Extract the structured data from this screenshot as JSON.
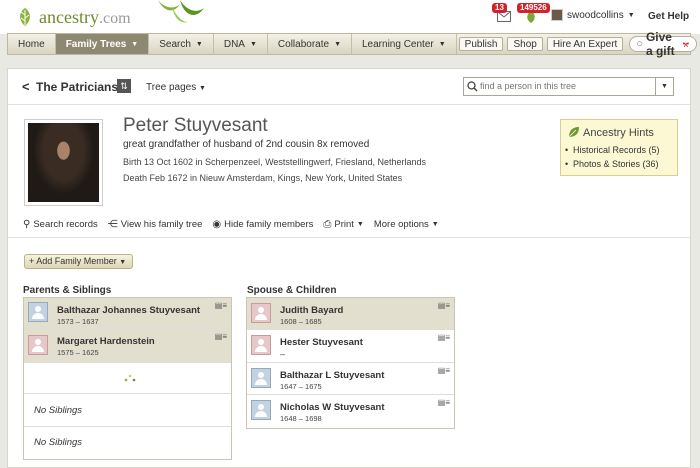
{
  "brand": {
    "logo_text": "ancestry",
    "logo_suffix": ".com",
    "accent": "#6e8b2f"
  },
  "header": {
    "messages_count": "13",
    "hints_count": "149526",
    "username": "swoodcollins",
    "help_label": "Get Help"
  },
  "nav": {
    "items": [
      {
        "label": "Home"
      },
      {
        "label": "Family Trees"
      },
      {
        "label": "Search"
      },
      {
        "label": "DNA"
      },
      {
        "label": "Collaborate"
      },
      {
        "label": "Learning Center"
      }
    ],
    "buttons": [
      {
        "label": "Publish"
      },
      {
        "label": "Shop"
      },
      {
        "label": "Hire An Expert"
      }
    ],
    "gift_label": "Give a gift"
  },
  "tree": {
    "back_glyph": "<",
    "name": "The Patricians!",
    "pages_label": "Tree pages",
    "find_placeholder": "find a person in this tree"
  },
  "person": {
    "name": "Peter Stuyvesant",
    "relation": "great grandfather of husband of 2nd cousin 8x removed",
    "birth": "Birth 13 Oct 1602 in Scherpenzeel, Weststellingwerf, Friesland, Netherlands",
    "death": "Death Feb 1672 in Nieuw Amsterdam, Kings, New York, United States"
  },
  "hints": {
    "title": "Ancestry Hints",
    "historical": "Historical Records (5)",
    "photos": "Photos & Stories (36)"
  },
  "actions": {
    "search": "Search records",
    "family_tree": "View his family tree",
    "hide": "Hide family members",
    "print": "Print",
    "more": "More options"
  },
  "add_member_label": "+ Add Family Member",
  "parents": {
    "title": "Parents & Siblings",
    "members": [
      {
        "name": "Balthazar Johannes Stuyvesant",
        "dates": "1573 – 1637"
      },
      {
        "name": "Margaret Hardenstein",
        "dates": "1575 – 1625"
      }
    ],
    "no_siblings_1": "No Siblings",
    "no_siblings_2": "No Siblings"
  },
  "spouse": {
    "title": "Spouse & Children",
    "members": [
      {
        "name": "Judith Bayard",
        "dates": "1608 – 1685"
      },
      {
        "name": "Hester Stuyvesant",
        "dates": "–"
      },
      {
        "name": "Balthazar L Stuyvesant",
        "dates": "1647 – 1675"
      },
      {
        "name": "Nicholas W Stuyvesant",
        "dates": "1648 – 1698"
      }
    ]
  }
}
